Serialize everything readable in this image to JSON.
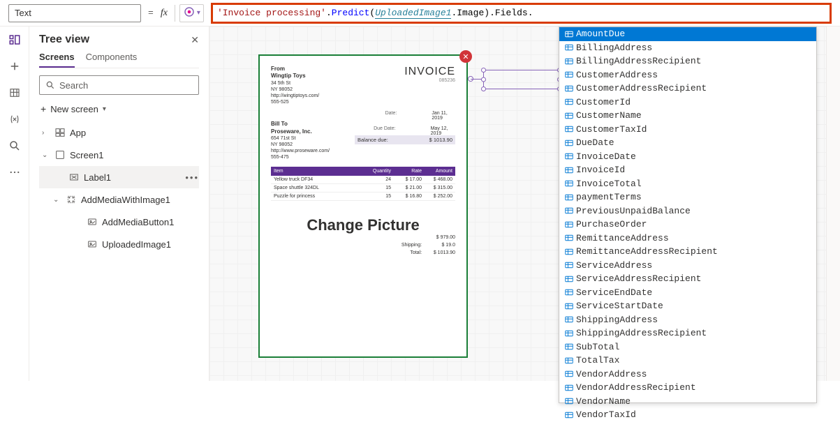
{
  "formula_bar": {
    "property": "Text",
    "tokens": {
      "str": "'Invoice processing'",
      "method": "Predict",
      "ident": "UploadedImage1",
      "prop1": "Image",
      "prop2": "Fields"
    }
  },
  "tree": {
    "title": "Tree view",
    "tabs": {
      "screens": "Screens",
      "components": "Components"
    },
    "search_placeholder": "Search",
    "new_screen": "New screen",
    "nodes": {
      "app": "App",
      "screen1": "Screen1",
      "label1": "Label1",
      "addmedia": "AddMediaWithImage1",
      "addmediabtn": "AddMediaButton1",
      "uploaded": "UploadedImage1"
    }
  },
  "autocomplete": [
    "AmountDue",
    "BillingAddress",
    "BillingAddressRecipient",
    "CustomerAddress",
    "CustomerAddressRecipient",
    "CustomerId",
    "CustomerName",
    "CustomerTaxId",
    "DueDate",
    "InvoiceDate",
    "InvoiceId",
    "InvoiceTotal",
    "paymentTerms",
    "PreviousUnpaidBalance",
    "PurchaseOrder",
    "RemittanceAddress",
    "RemittanceAddressRecipient",
    "ServiceAddress",
    "ServiceAddressRecipient",
    "ServiceEndDate",
    "ServiceStartDate",
    "ShippingAddress",
    "ShippingAddressRecipient",
    "SubTotal",
    "TotalTax",
    "VendorAddress",
    "VendorAddressRecipient",
    "VendorName",
    "VendorTaxId"
  ],
  "invoice": {
    "from_label": "From",
    "from_name": "Wingtip Toys",
    "from_addr1": "34 5th St",
    "from_addr2": "NY 98052",
    "from_site": "http://wingtiptoys.com/",
    "from_phone": "555-525",
    "title": "INVOICE",
    "number": "085236",
    "date_lbl": "Date:",
    "date_val": "Jan 11, 2019",
    "due_lbl": "Due Date:",
    "due_val": "May 12, 2019",
    "balance_lbl": "Balance due:",
    "balance_val": "$ 1013.90",
    "billto_label": "Bill To",
    "billto_name": "Proseware, Inc.",
    "billto_addr1": "654 71st St",
    "billto_addr2": "NY 98052",
    "billto_site": "http://www.proseware.com/",
    "billto_phone": "555-475",
    "th_item": "Item",
    "th_qty": "Quantity",
    "th_rate": "Rate",
    "th_amt": "Amount",
    "rows": [
      {
        "item": "Yellow truck DF34",
        "qty": "24",
        "rate": "$ 17.00",
        "amt": "$ 468.00"
      },
      {
        "item": "Space shuttle 324DL",
        "qty": "15",
        "rate": "$ 21.00",
        "amt": "$ 315.00"
      },
      {
        "item": "Puzzle for princess",
        "qty": "15",
        "rate": "$ 16.80",
        "amt": "$ 252.00"
      }
    ],
    "change_picture": "Change Picture",
    "totals": {
      "sub_lbl": "",
      "sub": "$ 979.00",
      "ship_lbl": "Shipping:",
      "ship": "$ 19.0",
      "tot_lbl": "Total:",
      "tot": "$ 1013.90"
    }
  }
}
